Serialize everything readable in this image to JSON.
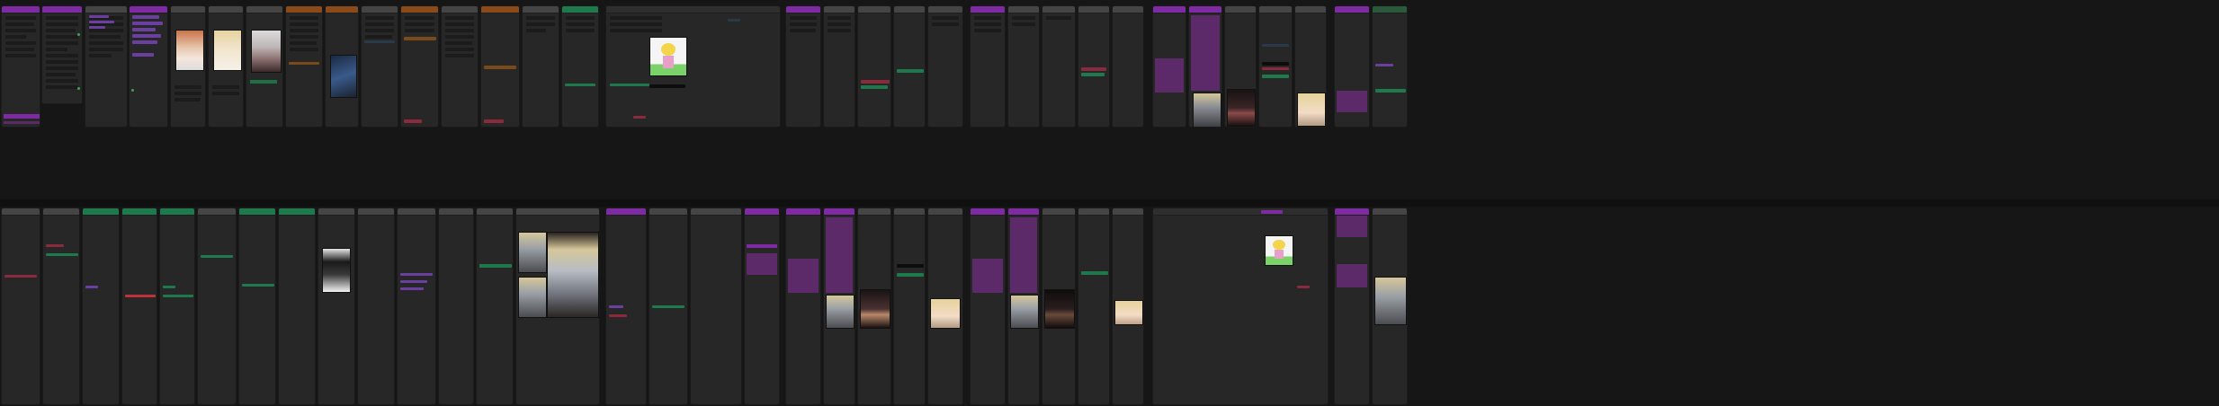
{
  "canvas": {
    "name": "node-graph-workflow",
    "background": "#161616"
  },
  "colors": {
    "node_bg": "#272727",
    "title_default": "#3a3a3a",
    "accent_purple": "#7d2aa3",
    "accent_green": "#1e7a4c",
    "accent_orange": "#8a4a1a",
    "accent_red": "#8a2a3c",
    "link_green": "#3fa05a",
    "link_blue": "#4a7fd0"
  },
  "images": [
    {
      "subject": "portrait-red-hair"
    },
    {
      "subject": "portrait-blonde"
    },
    {
      "subject": "portrait-white-hair"
    },
    {
      "subject": "figure-blue-outfit"
    },
    {
      "subject": "cartoon-character"
    },
    {
      "subject": "armored-figure"
    },
    {
      "subject": "dark-hair-portrait"
    },
    {
      "subject": "blonde-closeup"
    },
    {
      "subject": "black-white-figure"
    },
    {
      "subject": "armored-knight-large"
    }
  ]
}
